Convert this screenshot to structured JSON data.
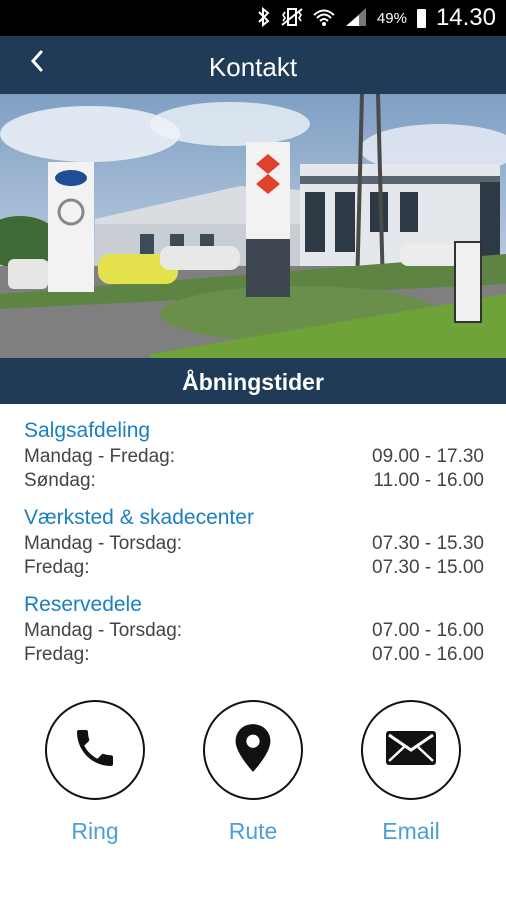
{
  "status_bar": {
    "battery": "49%",
    "time": "14.30",
    "icons": [
      "bluetooth-icon",
      "vibrate-icon",
      "wifi-icon",
      "signal-icon",
      "battery-icon"
    ]
  },
  "app_bar": {
    "title": "Kontakt",
    "back_icon": "chevron-left-icon"
  },
  "banner": {
    "title": "Åbningstider"
  },
  "hours": {
    "sections": [
      {
        "title": "Salgsafdeling",
        "rows": [
          {
            "day": "Mandag - Fredag:",
            "time": "09.00 - 17.30"
          },
          {
            "day": "Søndag:",
            "time": "11.00 - 16.00"
          }
        ]
      },
      {
        "title": "Værksted & skadecenter",
        "rows": [
          {
            "day": "Mandag - Torsdag:",
            "time": "07.30 - 15.30"
          },
          {
            "day": "Fredag:",
            "time": "07.30 - 15.00"
          }
        ]
      },
      {
        "title": "Reservedele",
        "rows": [
          {
            "day": "Mandag - Torsdag:",
            "time": "07.00 - 16.00"
          },
          {
            "day": "Fredag:",
            "time": "07.00 - 16.00"
          }
        ]
      }
    ]
  },
  "actions": {
    "call": {
      "label": "Ring",
      "icon": "phone-icon"
    },
    "route": {
      "label": "Rute",
      "icon": "map-pin-icon"
    },
    "email": {
      "label": "Email",
      "icon": "envelope-icon"
    }
  },
  "colors": {
    "app_bar": "#1f3b57",
    "section_title": "#1a7fc1",
    "action_label": "#4a9fd6"
  }
}
